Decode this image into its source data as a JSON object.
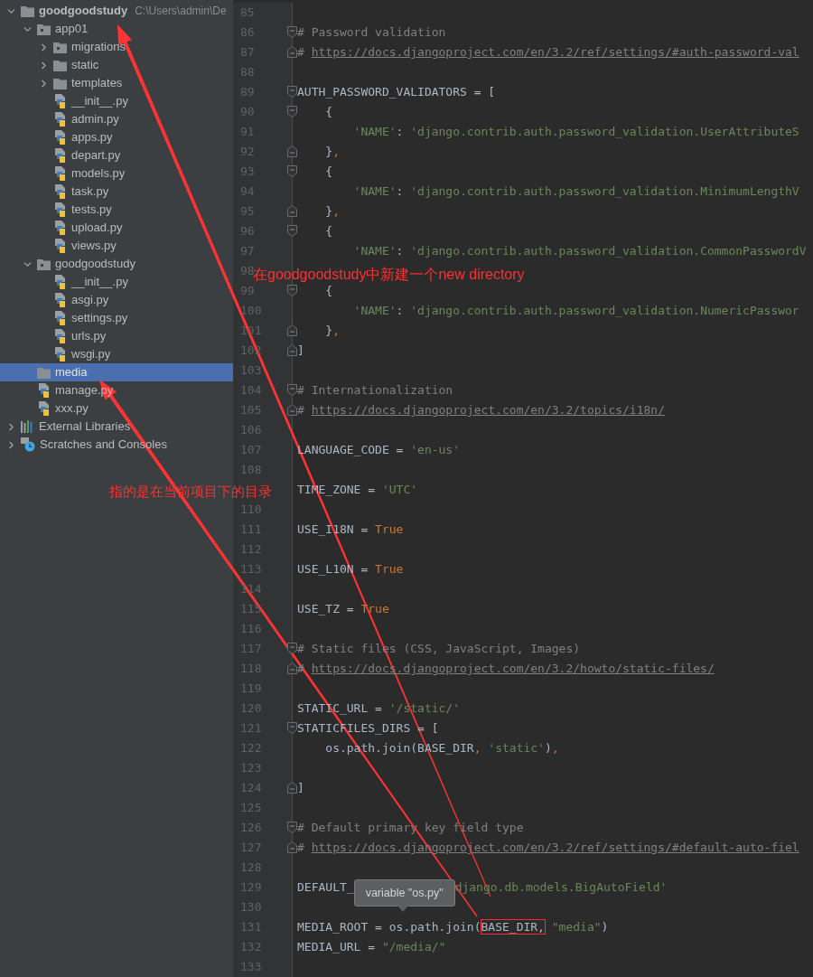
{
  "project_tree": [
    {
      "kind": "folder",
      "label": "goodgoodstudy",
      "path": "C:\\Users\\admin\\De",
      "expanded": true,
      "selected": false,
      "children": [
        {
          "kind": "package",
          "label": "app01",
          "expanded": true,
          "selected": false,
          "children": [
            {
              "kind": "package",
              "label": "migrations",
              "expanded": false,
              "selected": false
            },
            {
              "kind": "folder",
              "label": "static",
              "expanded": false,
              "selected": false
            },
            {
              "kind": "folder",
              "label": "templates",
              "expanded": false,
              "selected": false
            },
            {
              "kind": "python",
              "label": "__init__.py",
              "selected": false
            },
            {
              "kind": "python",
              "label": "admin.py",
              "selected": false
            },
            {
              "kind": "python",
              "label": "apps.py",
              "selected": false
            },
            {
              "kind": "python",
              "label": "depart.py",
              "selected": false
            },
            {
              "kind": "python",
              "label": "models.py",
              "selected": false
            },
            {
              "kind": "python",
              "label": "task.py",
              "selected": false
            },
            {
              "kind": "python",
              "label": "tests.py",
              "selected": false
            },
            {
              "kind": "python",
              "label": "upload.py",
              "selected": false
            },
            {
              "kind": "python",
              "label": "views.py",
              "selected": false
            }
          ]
        },
        {
          "kind": "package",
          "label": "goodgoodstudy",
          "expanded": true,
          "selected": false,
          "children": [
            {
              "kind": "python",
              "label": "__init__.py",
              "selected": false
            },
            {
              "kind": "python",
              "label": "asgi.py",
              "selected": false
            },
            {
              "kind": "python",
              "label": "settings.py",
              "selected": false
            },
            {
              "kind": "python",
              "label": "urls.py",
              "selected": false
            },
            {
              "kind": "python",
              "label": "wsgi.py",
              "selected": false
            }
          ]
        },
        {
          "kind": "folder",
          "label": "media",
          "selected": true
        },
        {
          "kind": "python",
          "label": "manage.py",
          "selected": false
        },
        {
          "kind": "python",
          "label": "xxx.py",
          "selected": false
        }
      ]
    },
    {
      "kind": "libraries",
      "label": "External Libraries",
      "expanded": false,
      "selected": false
    },
    {
      "kind": "scratches",
      "label": "Scratches and Consoles",
      "expanded": false,
      "selected": false
    }
  ],
  "editor": {
    "lines": [
      {
        "number": "85"
      },
      {
        "number": "86",
        "fold_end": false,
        "tokens": [
          {
            "kind": "comment",
            "text": "# Password validation"
          }
        ]
      },
      {
        "number": "87",
        "fold_end": true,
        "tokens": [
          {
            "kind": "comment",
            "text": "# "
          },
          {
            "kind": "link",
            "text": "https://docs.djangoproject.com/en/3.2/ref/settings/#auth-password-val"
          }
        ]
      },
      {
        "number": "88"
      },
      {
        "number": "89",
        "fold_end": false,
        "tokens": [
          {
            "kind": "plain",
            "text": "AUTH_PASSWORD_VALIDATORS = ["
          }
        ]
      },
      {
        "number": "90",
        "fold_end": false,
        "tokens": [
          {
            "kind": "plain",
            "text": "    {"
          }
        ]
      },
      {
        "number": "91",
        "tokens": [
          {
            "kind": "string",
            "text": "        'NAME'"
          },
          {
            "kind": "plain",
            "text": ": "
          },
          {
            "kind": "string",
            "text": "'django.contrib.auth.password_validation.UserAttributeS"
          }
        ]
      },
      {
        "number": "92",
        "fold_end": true,
        "tokens": [
          {
            "kind": "plain",
            "text": "    }"
          },
          {
            "kind": "punct",
            "text": ","
          }
        ]
      },
      {
        "number": "93",
        "fold_end": false,
        "tokens": [
          {
            "kind": "plain",
            "text": "    {"
          }
        ]
      },
      {
        "number": "94",
        "tokens": [
          {
            "kind": "string",
            "text": "        'NAME'"
          },
          {
            "kind": "plain",
            "text": ": "
          },
          {
            "kind": "string",
            "text": "'django.contrib.auth.password_validation.MinimumLengthV"
          }
        ]
      },
      {
        "number": "95",
        "fold_end": true,
        "tokens": [
          {
            "kind": "plain",
            "text": "    }"
          },
          {
            "kind": "punct",
            "text": ","
          }
        ]
      },
      {
        "number": "96",
        "fold_end": false,
        "tokens": [
          {
            "kind": "plain",
            "text": "    {"
          }
        ]
      },
      {
        "number": "97",
        "tokens": [
          {
            "kind": "string",
            "text": "        'NAME'"
          },
          {
            "kind": "plain",
            "text": ": "
          },
          {
            "kind": "string",
            "text": "'django.contrib.auth.password_validation.CommonPasswordV"
          }
        ]
      },
      {
        "number": "98"
      },
      {
        "number": "99",
        "fold_end": false,
        "tokens": [
          {
            "kind": "plain",
            "text": "    {"
          }
        ]
      },
      {
        "number": "100",
        "tokens": [
          {
            "kind": "string",
            "text": "        'NAME'"
          },
          {
            "kind": "plain",
            "text": ": "
          },
          {
            "kind": "string",
            "text": "'django.contrib.auth.password_validation.NumericPasswor"
          }
        ]
      },
      {
        "number": "101",
        "fold_end": true,
        "tokens": [
          {
            "kind": "plain",
            "text": "    }"
          },
          {
            "kind": "punct",
            "text": ","
          }
        ]
      },
      {
        "number": "102",
        "fold_end": true,
        "tokens": [
          {
            "kind": "plain",
            "text": "]"
          }
        ]
      },
      {
        "number": "103"
      },
      {
        "number": "104",
        "fold_end": false,
        "tokens": [
          {
            "kind": "comment",
            "text": "# Internationalization"
          }
        ]
      },
      {
        "number": "105",
        "fold_end": true,
        "tokens": [
          {
            "kind": "comment",
            "text": "# "
          },
          {
            "kind": "link",
            "text": "https://docs.djangoproject.com/en/3.2/topics/i18n/"
          }
        ]
      },
      {
        "number": "106"
      },
      {
        "number": "107",
        "tokens": [
          {
            "kind": "plain",
            "text": "LANGUAGE_CODE = "
          },
          {
            "kind": "string",
            "text": "'en-us'"
          }
        ]
      },
      {
        "number": "108"
      },
      {
        "tokens": [
          {
            "kind": "plain",
            "text": "TIME_ZONE = "
          },
          {
            "kind": "string",
            "text": "'UTC'"
          }
        ]
      },
      {
        "number": "110"
      },
      {
        "number": "111",
        "tokens": [
          {
            "kind": "plain",
            "text": "USE_I18N = "
          },
          {
            "kind": "keyword",
            "text": "True"
          }
        ]
      },
      {
        "number": "112"
      },
      {
        "number": "113",
        "tokens": [
          {
            "kind": "plain",
            "text": "USE_L10N = "
          },
          {
            "kind": "keyword",
            "text": "True"
          }
        ]
      },
      {
        "number": "114"
      },
      {
        "number": "115",
        "tokens": [
          {
            "kind": "plain",
            "text": "USE_TZ = "
          },
          {
            "kind": "keyword",
            "text": "True"
          }
        ]
      },
      {
        "number": "116"
      },
      {
        "number": "117",
        "fold_end": false,
        "tokens": [
          {
            "kind": "comment",
            "text": "# Static files (CSS, JavaScript, Images)"
          }
        ]
      },
      {
        "number": "118",
        "fold_end": true,
        "tokens": [
          {
            "kind": "comment",
            "text": "# "
          },
          {
            "kind": "link",
            "text": "https://docs.djangoproject.com/en/3.2/howto/static-files/"
          }
        ]
      },
      {
        "number": "119"
      },
      {
        "number": "120",
        "tokens": [
          {
            "kind": "plain",
            "text": "STATIC_URL = "
          },
          {
            "kind": "string",
            "text": "'/static/'"
          }
        ]
      },
      {
        "number": "121",
        "fold_end": false,
        "tokens": [
          {
            "kind": "plain",
            "text": "STATICFILES_DIRS = ["
          }
        ]
      },
      {
        "number": "122",
        "tokens": [
          {
            "kind": "plain",
            "text": "    os.path.join(BASE_DIR"
          },
          {
            "kind": "punct",
            "text": ", "
          },
          {
            "kind": "string",
            "text": "'static'"
          },
          {
            "kind": "plain",
            "text": ")"
          },
          {
            "kind": "punct",
            "text": ","
          }
        ]
      },
      {
        "number": "123"
      },
      {
        "number": "124",
        "fold_end": true,
        "tokens": [
          {
            "kind": "plain",
            "text": "]"
          }
        ]
      },
      {
        "number": "125"
      },
      {
        "number": "126",
        "fold_end": false,
        "tokens": [
          {
            "kind": "comment",
            "text": "# Default primary key field type"
          }
        ]
      },
      {
        "number": "127",
        "fold_end": true,
        "tokens": [
          {
            "kind": "comment",
            "text": "# "
          },
          {
            "kind": "link",
            "text": "https://docs.djangoproject.com/en/3.2/ref/settings/#default-auto-fiel"
          }
        ]
      },
      {
        "number": "128"
      },
      {
        "number": "129",
        "tokens": [
          {
            "kind": "plain",
            "text": "DEFAULT_"
          },
          {
            "kind": "tooltip",
            "text": "variable \"os.py\""
          },
          {
            "kind": "string",
            "text": "django.db.models.BigAutoField'"
          }
        ]
      },
      {
        "number": "130"
      },
      {
        "number": "131",
        "tokens": [
          {
            "kind": "plain",
            "text": "MEDIA_ROOT = os.path.join("
          },
          {
            "kind": "boxed",
            "text": "BASE_DIR,"
          },
          {
            "kind": "string",
            "text": " \"media\""
          },
          {
            "kind": "plain",
            "text": ")"
          }
        ]
      },
      {
        "number": "132",
        "tokens": [
          {
            "kind": "plain",
            "text": "MEDIA_URL = "
          },
          {
            "kind": "string",
            "text": "\"/media/\""
          }
        ]
      },
      {
        "number": "133"
      }
    ]
  },
  "annotations": [
    {
      "kind": "note",
      "text": "在goodgoodstudy中新建一个new directory"
    },
    {
      "kind": "note",
      "text": "指的是在当前项目下的目录"
    }
  ]
}
